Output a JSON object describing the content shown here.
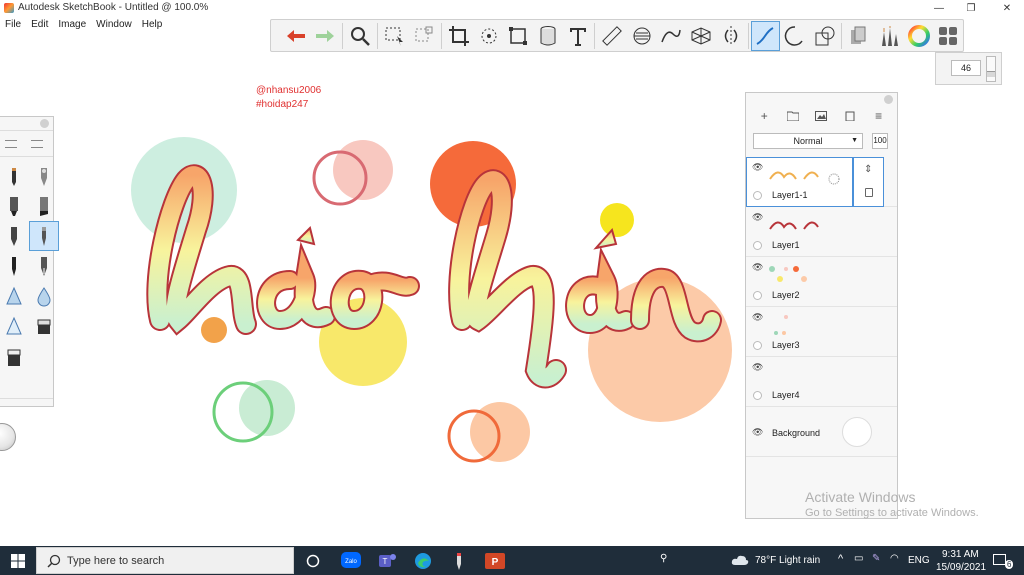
{
  "window": {
    "title": "Autodesk SketchBook - Untitled @ 100.0%",
    "controls": {
      "minimize": "—",
      "maximize": "❐",
      "close": "✕"
    }
  },
  "menu": [
    "File",
    "Edit",
    "Image",
    "Window",
    "Help"
  ],
  "toolbar": {
    "tools": [
      "undo-icon",
      "redo-icon",
      "zoom-icon",
      "select-icon",
      "transform-icon",
      "crop-icon",
      "lasso-icon",
      "fill-icon",
      "canvas-icon",
      "text-icon",
      "ruler-icon",
      "ellipse-guide-icon",
      "curve-guide-icon",
      "perspective-icon",
      "symmetry-icon",
      "stroke-icon",
      "circle-icon",
      "shape-icon",
      "copic-icon",
      "brush-library-icon",
      "color-wheel-icon",
      "palette-icon"
    ],
    "active": "stroke-icon"
  },
  "brush_size": "46",
  "watermark": {
    "line1": "@nhansu2006",
    "line2": "#hoidap247"
  },
  "layers": {
    "blend_mode": "Normal",
    "opacity": "100",
    "items": [
      {
        "name": "Layer1-1",
        "selected": true
      },
      {
        "name": "Layer1",
        "selected": false
      },
      {
        "name": "Layer2",
        "selected": false
      },
      {
        "name": "Layer3",
        "selected": false
      },
      {
        "name": "Layer4",
        "selected": false
      },
      {
        "name": "Background",
        "selected": false
      }
    ]
  },
  "activate_windows": {
    "title": "Activate Windows",
    "subtitle": "Go to Settings to activate Windows."
  },
  "taskbar": {
    "search_placeholder": "Type here to search",
    "apps": [
      "cortana-icon",
      "zalo-icon",
      "teams-icon",
      "edge-icon",
      "sketchbook-icon",
      "powerpoint-icon"
    ],
    "weather": "78°F  Light rain",
    "language": "ENG",
    "time": "9:31 AM",
    "date": "15/09/2021",
    "notifications": "6"
  },
  "colors": {
    "accent": "#4a90d9",
    "taskbar": "#1f2d3a",
    "watermark": "#e03030"
  }
}
